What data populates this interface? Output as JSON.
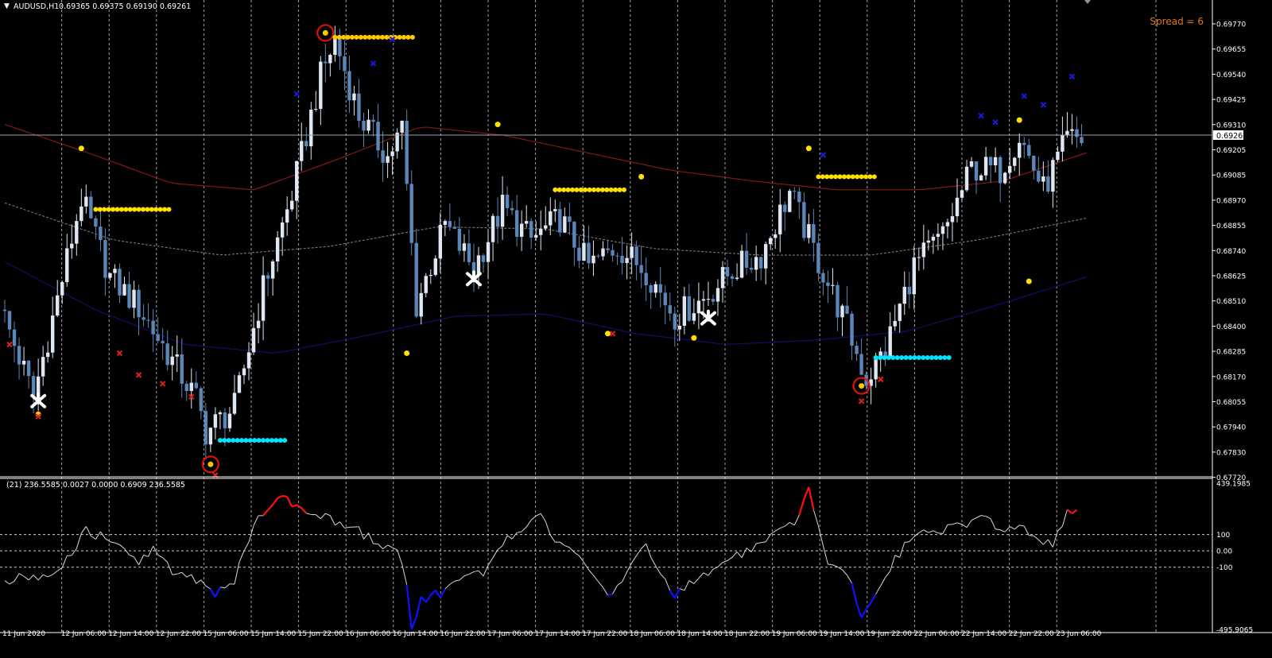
{
  "header": {
    "symbol_label": "AUDUSD,H1",
    "ohlc": "0.69365 0.69375 0.69190 0.69261",
    "spread": "Spread = 6"
  },
  "oscillator": {
    "label": "(21) 236.5585 0.0027 0.0000 0.6909 236.5585",
    "y_ticks": [
      "439.1985",
      "100",
      "0.00",
      "-100",
      "-495.9065"
    ],
    "max": 439.1985,
    "min": -495.9065,
    "levels": [
      100,
      0,
      -100
    ]
  },
  "colors": {
    "background": "#000000",
    "bull_candle": "#dfe8f2",
    "bear_candle": "#5a86b8",
    "red_ma": "#8b1a1a",
    "blue_ma": "#10106e",
    "gray_ma": "#7a7a7a",
    "dot_yellow": "#ffe000",
    "dot_orange": "#ffc800",
    "dot_cyan": "#00e5ff",
    "cross_red": "#e02020",
    "cross_blue": "#1a1ae0",
    "circle_red": "#e01010",
    "cci_line": "#d8d8d8",
    "cci_high": "#ff1010",
    "cci_low": "#1010ff",
    "current_price_line": "#9aa4ad",
    "spread_text": "#e07a10"
  },
  "chart_data": [
    {
      "type": "candlestick",
      "title": "AUDUSD,H1",
      "ylim": [
        0.6772,
        0.6985
      ],
      "y_ticks": [
        "0.69770",
        "0.69655",
        "0.69540",
        "0.69425",
        "0.69310",
        "0.69205",
        "0.69085",
        "0.68970",
        "0.68855",
        "0.68740",
        "0.68625",
        "0.68510",
        "0.68400",
        "0.68285",
        "0.68170",
        "0.68055",
        "0.67940",
        "0.67830",
        "0.67720"
      ],
      "x_ticks": [
        "11 Jun 2020",
        "12 Jun 06:00",
        "12 Jun 14:00",
        "12 Jun 22:00",
        "15 Jun 06:00",
        "15 Jun 14:00",
        "15 Jun 22:00",
        "16 Jun 06:00",
        "16 Jun 14:00",
        "16 Jun 22:00",
        "17 Jun 06:00",
        "17 Jun 14:00",
        "17 Jun 22:00",
        "18 Jun 06:00",
        "18 Jun 14:00",
        "18 Jun 22:00",
        "19 Jun 06:00",
        "19 Jun 14:00",
        "19 Jun 22:00",
        "22 Jun 06:00",
        "22 Jun 14:00",
        "22 Jun 22:00",
        "23 Jun 06:00"
      ],
      "current_price": "0.69261",
      "close_anchors": [
        [
          0,
          0.6844
        ],
        [
          6,
          0.6808
        ],
        [
          12,
          0.6862
        ],
        [
          16,
          0.6899
        ],
        [
          22,
          0.6863
        ],
        [
          28,
          0.6849
        ],
        [
          34,
          0.6828
        ],
        [
          40,
          0.6807
        ],
        [
          42,
          0.6792
        ],
        [
          48,
          0.6803
        ],
        [
          54,
          0.6858
        ],
        [
          60,
          0.6901
        ],
        [
          66,
          0.6955
        ],
        [
          69,
          0.6972
        ],
        [
          74,
          0.6937
        ],
        [
          80,
          0.6918
        ],
        [
          83,
          0.6931
        ],
        [
          86,
          0.685
        ],
        [
          92,
          0.6887
        ],
        [
          98,
          0.6867
        ],
        [
          104,
          0.6895
        ],
        [
          110,
          0.688
        ],
        [
          116,
          0.689
        ],
        [
          122,
          0.6868
        ],
        [
          128,
          0.6877
        ],
        [
          134,
          0.6866
        ],
        [
          140,
          0.6845
        ],
        [
          146,
          0.6853
        ],
        [
          152,
          0.6866
        ],
        [
          158,
          0.6873
        ],
        [
          164,
          0.6902
        ],
        [
          170,
          0.687
        ],
        [
          176,
          0.684
        ],
        [
          180,
          0.6816
        ],
        [
          184,
          0.683
        ],
        [
          190,
          0.6868
        ],
        [
          196,
          0.6882
        ],
        [
          202,
          0.6913
        ],
        [
          208,
          0.6912
        ],
        [
          212,
          0.6928
        ],
        [
          217,
          0.6903
        ],
        [
          222,
          0.6926
        ]
      ],
      "moving_averages": [
        {
          "color": "red",
          "values": [
            0.6933,
            0.692,
            0.6906,
            0.6903,
            0.6917,
            0.6932,
            0.6928,
            0.692,
            0.6912,
            0.6907,
            0.6903,
            0.6903,
            0.6907,
            0.692
          ]
        },
        {
          "color": "gray",
          "style": "dashed",
          "values": [
            0.6897,
            0.688,
            0.6873,
            0.6877,
            0.6886,
            0.6885,
            0.6876,
            0.6873,
            0.6873,
            0.688,
            0.689
          ]
        },
        {
          "color": "blue",
          "values": [
            0.687,
            0.6848,
            0.6832,
            0.6828,
            0.6836,
            0.6845,
            0.6846,
            0.6837,
            0.6832,
            0.6834,
            0.6838,
            0.685,
            0.6863
          ]
        }
      ],
      "markers": [
        {
          "type": "circle-red",
          "x": 43,
          "y": 0.6777
        },
        {
          "type": "circle-red",
          "x": 67,
          "y": 0.6975
        },
        {
          "type": "circle-red",
          "x": 179,
          "y": 0.6813
        },
        {
          "type": "dot-run",
          "color": "yellow",
          "x0": 19,
          "x1": 35,
          "y": 0.6894
        },
        {
          "type": "dot-run",
          "color": "orange",
          "x0": 69,
          "x1": 86,
          "y": 0.6973
        },
        {
          "type": "dot-run",
          "color": "cyan",
          "x0": 45,
          "x1": 59,
          "y": 0.6788
        },
        {
          "type": "dot-run",
          "color": "yellow",
          "x0": 115,
          "x1": 130,
          "y": 0.6903
        },
        {
          "type": "dot-run",
          "color": "yellow",
          "x0": 170,
          "x1": 182,
          "y": 0.6909
        },
        {
          "type": "dot-run",
          "color": "cyan",
          "x0": 182,
          "x1": 198,
          "y": 0.6826
        },
        {
          "type": "dot",
          "color": "yellow",
          "x": 16,
          "y": 0.6922
        },
        {
          "type": "dot",
          "color": "yellow",
          "x": 103,
          "y": 0.6933
        },
        {
          "type": "dot",
          "color": "yellow",
          "x": 84,
          "y": 0.6828
        },
        {
          "type": "dot",
          "color": "yellow",
          "x": 133,
          "y": 0.6909
        },
        {
          "type": "dot",
          "color": "yellow",
          "x": 126,
          "y": 0.6837
        },
        {
          "type": "dot",
          "color": "yellow",
          "x": 144,
          "y": 0.6835
        },
        {
          "type": "dot",
          "color": "yellow",
          "x": 168,
          "y": 0.6922
        },
        {
          "type": "dot",
          "color": "yellow",
          "x": 212,
          "y": 0.6935
        },
        {
          "type": "dot",
          "color": "yellow",
          "x": 214,
          "y": 0.6861
        },
        {
          "type": "dot",
          "color": "orange",
          "x": 7,
          "y": 0.68
        },
        {
          "type": "xmark",
          "color": "red",
          "x": 1,
          "y": 0.6832
        },
        {
          "type": "xmark",
          "color": "red",
          "x": 24,
          "y": 0.6828
        },
        {
          "type": "xmark",
          "color": "red",
          "x": 28,
          "y": 0.6818
        },
        {
          "type": "xmark",
          "color": "red",
          "x": 33,
          "y": 0.6814
        },
        {
          "type": "xmark",
          "color": "red",
          "x": 39,
          "y": 0.6808
        },
        {
          "type": "xmark",
          "color": "red",
          "x": 44,
          "y": 0.6772
        },
        {
          "type": "xmark",
          "color": "red",
          "x": 127,
          "y": 0.6837
        },
        {
          "type": "xmark",
          "color": "red",
          "x": 179,
          "y": 0.6806
        },
        {
          "type": "xmark",
          "color": "red",
          "x": 183,
          "y": 0.6816
        },
        {
          "type": "xmark",
          "color": "red",
          "x": 7,
          "y": 0.6799
        },
        {
          "type": "xmark",
          "color": "blue",
          "x": 61,
          "y": 0.6947
        },
        {
          "type": "xmark",
          "color": "blue",
          "x": 77,
          "y": 0.6961
        },
        {
          "type": "xmark",
          "color": "blue",
          "x": 81,
          "y": 0.6972
        },
        {
          "type": "xmark",
          "color": "blue",
          "x": 171,
          "y": 0.6919
        },
        {
          "type": "xmark",
          "color": "blue",
          "x": 204,
          "y": 0.6937
        },
        {
          "type": "xmark",
          "color": "blue",
          "x": 207,
          "y": 0.6934
        },
        {
          "type": "xmark",
          "color": "blue",
          "x": 213,
          "y": 0.6946
        },
        {
          "type": "xmark",
          "color": "blue",
          "x": 217,
          "y": 0.6942
        },
        {
          "type": "xmark",
          "color": "blue",
          "x": 223,
          "y": 0.6955
        },
        {
          "type": "star-white",
          "x": 7,
          "y": 0.6806
        },
        {
          "type": "star-white",
          "x": 98,
          "y": 0.6862
        },
        {
          "type": "star-white",
          "x": 147,
          "y": 0.6844
        }
      ]
    },
    {
      "type": "line",
      "title": "(21)",
      "ylim": [
        -495.9065,
        439.1985
      ],
      "anchors": [
        [
          0,
          -180
        ],
        [
          4,
          -160
        ],
        [
          7,
          -170
        ],
        [
          12,
          -80
        ],
        [
          17,
          120
        ],
        [
          20,
          90
        ],
        [
          24,
          60
        ],
        [
          28,
          -80
        ],
        [
          31,
          10
        ],
        [
          35,
          -130
        ],
        [
          38,
          -150
        ],
        [
          42,
          -200
        ],
        [
          44,
          -260
        ],
        [
          48,
          -180
        ],
        [
          52,
          150
        ],
        [
          56,
          300
        ],
        [
          58,
          320
        ],
        [
          62,
          260
        ],
        [
          66,
          220
        ],
        [
          70,
          160
        ],
        [
          74,
          120
        ],
        [
          78,
          40
        ],
        [
          82,
          0
        ],
        [
          84,
          -190
        ],
        [
          85,
          -460
        ],
        [
          87,
          -300
        ],
        [
          92,
          -250
        ],
        [
          96,
          -160
        ],
        [
          100,
          -130
        ],
        [
          104,
          50
        ],
        [
          108,
          120
        ],
        [
          112,
          230
        ],
        [
          114,
          90
        ],
        [
          118,
          40
        ],
        [
          122,
          -130
        ],
        [
          126,
          -290
        ],
        [
          130,
          -120
        ],
        [
          134,
          60
        ],
        [
          136,
          -110
        ],
        [
          140,
          -280
        ],
        [
          143,
          -200
        ],
        [
          146,
          -150
        ],
        [
          150,
          -70
        ],
        [
          154,
          -20
        ],
        [
          158,
          30
        ],
        [
          162,
          130
        ],
        [
          165,
          160
        ],
        [
          168,
          380
        ],
        [
          170,
          130
        ],
        [
          172,
          -80
        ],
        [
          176,
          -130
        ],
        [
          179,
          -380
        ],
        [
          182,
          -260
        ],
        [
          186,
          -50
        ],
        [
          190,
          100
        ],
        [
          196,
          130
        ],
        [
          200,
          160
        ],
        [
          204,
          200
        ],
        [
          208,
          140
        ],
        [
          212,
          150
        ],
        [
          216,
          60
        ],
        [
          219,
          30
        ],
        [
          222,
          240
        ]
      ]
    }
  ]
}
